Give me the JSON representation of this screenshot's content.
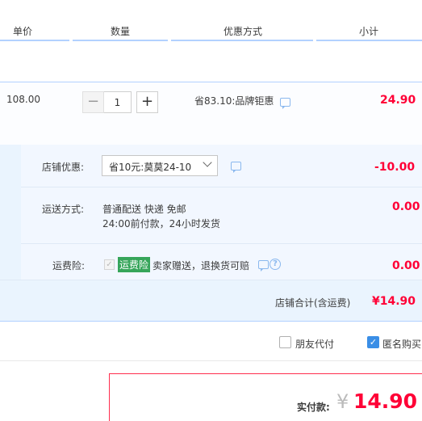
{
  "header": {
    "col_price": "单价",
    "col_qty": "数量",
    "col_promo": "优惠方式",
    "col_subtotal": "小计"
  },
  "item": {
    "unit_price": "108.00",
    "quantity": "1",
    "minus_label": "−",
    "plus_label": "+",
    "promo_text": "省83.10:品牌钜惠",
    "subtotal": "24.90"
  },
  "shop": {
    "discount_label": "店铺优惠:",
    "discount_selected": "省10元:莫莫24-10",
    "discount_amount": "-10.00",
    "shipping_label": "运送方式:",
    "shipping_line1": "普通配送 快递 免邮",
    "shipping_line2": "24:00前付款，24小时发货",
    "shipping_amount": "0.00",
    "insurance_label": "运费险:",
    "insurance_tag": "运费险",
    "insurance_text": "卖家赠送，退换货可赔",
    "insurance_amount": "0.00",
    "total_label": "店铺合计(含运费)",
    "total_amount": "¥14.90"
  },
  "options": {
    "friend_pay": "朋友代付",
    "anonymous": "匿名购买",
    "anonymous_checked": true
  },
  "payment": {
    "label": "实付款:",
    "currency": "¥",
    "amount": "14.90"
  },
  "colors": {
    "accent_blue": "#b2d1ff",
    "price_red": "#ff0036",
    "tag_green": "#36a55a"
  }
}
